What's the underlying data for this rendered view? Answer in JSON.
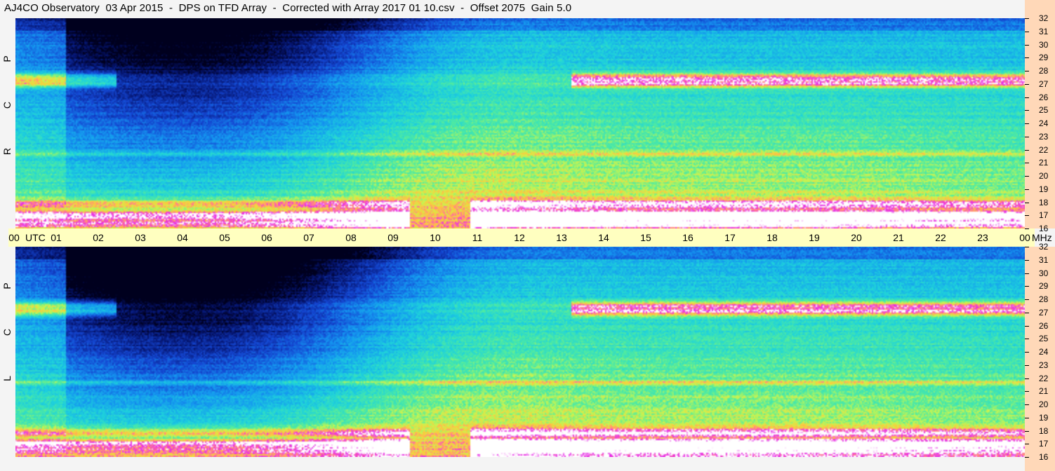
{
  "title": "AJ4CO Observatory  03 Apr 2015  -  DPS on TFD Array  -  Corrected with Array 2017 01 10.csv  -  Offset 2075  Gain 5.0",
  "panes": [
    {
      "label": [
        "R",
        "C",
        "P"
      ]
    },
    {
      "label": [
        "L",
        "C",
        "P"
      ]
    }
  ],
  "utc_axis": {
    "ticks": [
      "00",
      "01",
      "02",
      "03",
      "04",
      "05",
      "06",
      "07",
      "08",
      "09",
      "10",
      "11",
      "12",
      "13",
      "14",
      "15",
      "16",
      "17",
      "18",
      "19",
      "20",
      "21",
      "22",
      "23",
      "00"
    ],
    "unit_label": "UTC",
    "freq_unit": "MHz"
  },
  "mhz_scale": {
    "labels": [
      32,
      31,
      30,
      29,
      28,
      27,
      26,
      25,
      24,
      23,
      22,
      21,
      20,
      19,
      18,
      17,
      16
    ]
  },
  "colors": {
    "utc_bar": "#ffffc0",
    "scale_bg": "#ffd8b8",
    "page_bg": "#f4f4f4"
  }
}
